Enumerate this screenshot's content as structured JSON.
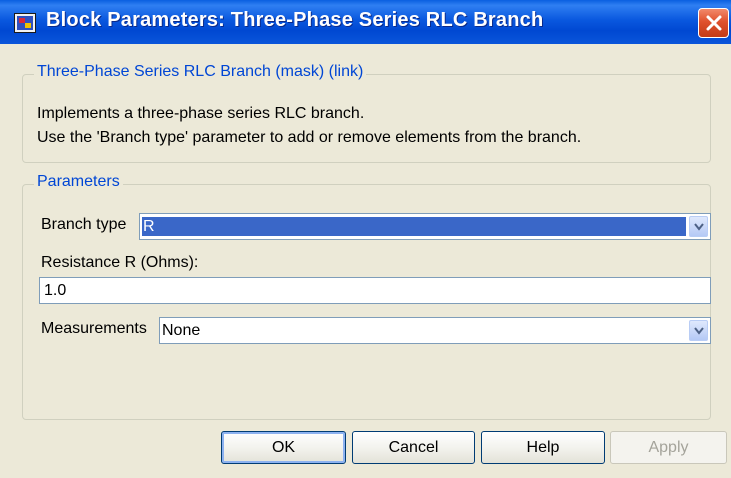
{
  "window": {
    "title": "Block Parameters: Three-Phase Series RLC Branch",
    "icon": "simulink-block-icon",
    "close_icon": "close-icon"
  },
  "description_group": {
    "legend": "Three-Phase Series RLC Branch (mask) (link)",
    "line1": "Implements a three-phase series RLC branch.",
    "line2": "Use the 'Branch type' parameter to add or remove elements from the branch."
  },
  "parameters_group": {
    "legend": "Parameters",
    "branch_type": {
      "label": "Branch type",
      "value": "R"
    },
    "resistance": {
      "label": "Resistance R (Ohms):",
      "value": "1.0"
    },
    "measurements": {
      "label": "Measurements",
      "value": "None"
    }
  },
  "buttons": {
    "ok": "OK",
    "cancel": "Cancel",
    "help": "Help",
    "apply": "Apply"
  },
  "colors": {
    "titlebar": "#0a58df",
    "legend_text": "#0046d5",
    "dialog_bg": "#ece9d8",
    "selection": "#3a67c8"
  }
}
